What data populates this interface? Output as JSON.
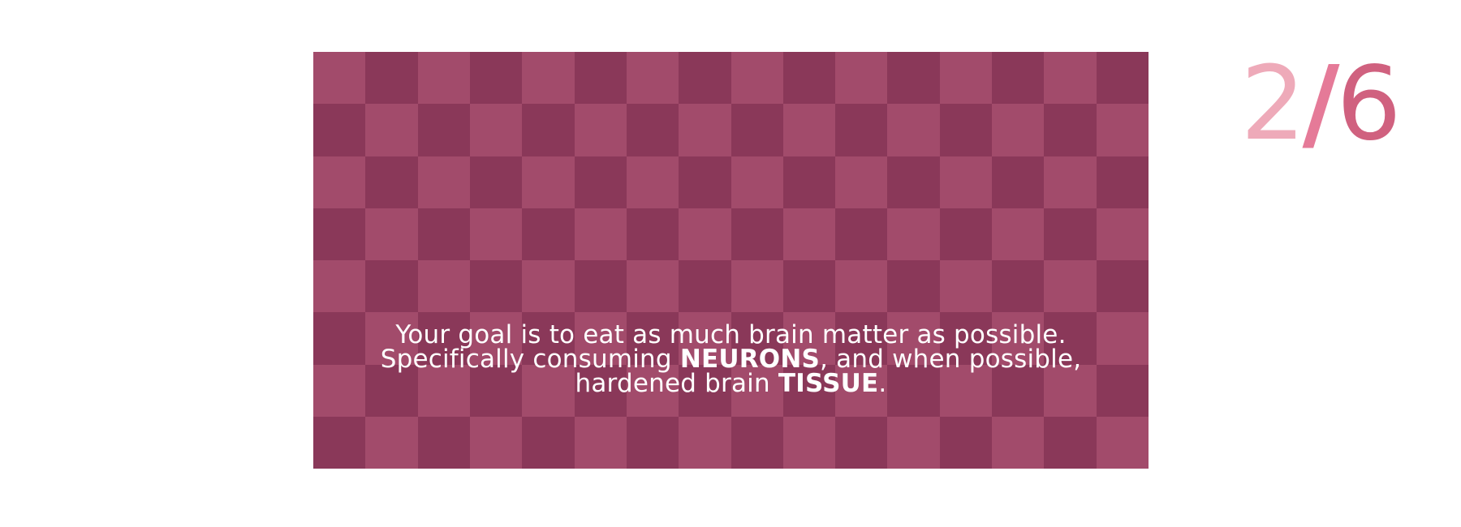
{
  "tutorial": {
    "caption": {
      "line1": "Your goal is to eat as much brain matter as possible.",
      "line2_prefix": "Specifically consuming ",
      "line2_bold": "NEURONS",
      "line2_suffix": ", and when possible,",
      "line3_prefix": "hardened brain ",
      "line3_bold": "TISSUE",
      "line3_suffix": "."
    },
    "counter": {
      "current": "2",
      "separator": "/",
      "total": "6"
    }
  },
  "board": {
    "columns": 16,
    "rows": 8,
    "tile_color_light": "#a24b6b",
    "tile_color_dark": "#8a3859"
  },
  "colors": {
    "counter_current": "#eeaab9",
    "counter_separator": "#e57a98",
    "counter_total": "#d0617f",
    "caption_text": "#ffffff",
    "background": "#ffffff"
  }
}
